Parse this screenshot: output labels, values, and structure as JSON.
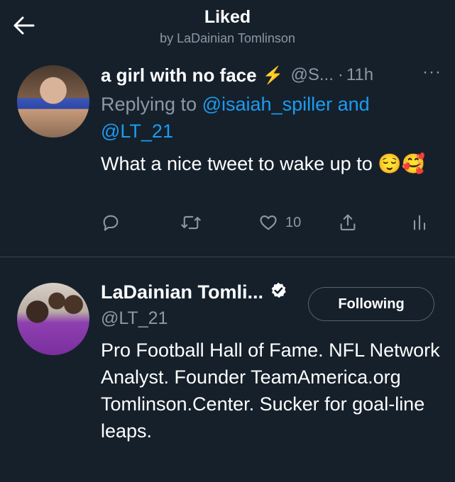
{
  "header": {
    "title": "Liked",
    "subtitle": "by LaDainian Tomlinson"
  },
  "tweet": {
    "author_name": "a girl with no face",
    "author_emoji": "⚡",
    "author_handle": "@S...",
    "separator": "·",
    "time": "11h",
    "more": "···",
    "replying_prefix": "Replying to",
    "mention_1": "@isaiah_spiller",
    "replying_and": "and",
    "mention_2": "@LT_21",
    "text": "What a nice tweet to wake up to 😌🥰",
    "like_count": "10"
  },
  "profile": {
    "name": "LaDainian Tomli...",
    "handle": "@LT_21",
    "follow_label": "Following",
    "bio": "Pro Football Hall of Fame. NFL Network Analyst. Founder TeamAmerica.org Tomlinson.Center. Sucker for goal-line leaps."
  },
  "icons": {
    "back": "arrow-left-icon",
    "reply": "reply-icon",
    "retweet": "retweet-icon",
    "like": "heart-icon",
    "share": "share-icon",
    "analytics": "analytics-icon",
    "verified": "verified-badge-icon"
  },
  "colors": {
    "background": "#15202b",
    "secondary_text": "#8b98a5",
    "link": "#1d9bf0",
    "divider": "#38444d"
  }
}
